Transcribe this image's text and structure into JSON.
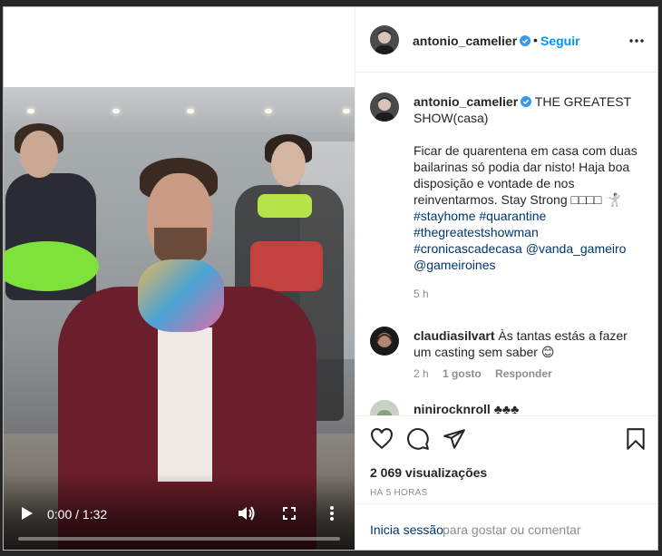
{
  "header": {
    "username": "antonio_camelier",
    "dot": "•",
    "follow": "Seguir"
  },
  "caption": {
    "username": "antonio_camelier",
    "title": "THE GREATEST SHOW(casa)",
    "body": "Ficar de quarentena em casa com duas bailarinas só podia dar nisto! Haja boa disposição e vontade de nos reinventarmos. Stay Strong □□□□ 🤺",
    "tags": [
      "#stayhome",
      "#quarantine",
      "#thegreatestshowman",
      "#cronicascadecasa",
      "@vanda_gameiro",
      "@gameiroines"
    ],
    "time": "5 h"
  },
  "comments": [
    {
      "username": "claudiasilvart",
      "text": "Às tantas estás a fazer um casting sem saber 😊",
      "time": "2 h",
      "likes": "1 gosto",
      "reply": "Responder"
    },
    {
      "username": "ninirocknroll",
      "text": "♣♣♣"
    }
  ],
  "video": {
    "time": "0:00 / 1:32",
    "progress": 0.0
  },
  "stats": {
    "views": "2 069 visualizações",
    "date": "HÁ 5 HORAS"
  },
  "login": {
    "link": "Inicia sessão",
    "rest": "para gostar ou comentar"
  },
  "icons": {
    "verified": "verified-badge-icon",
    "like": "heart-icon",
    "comment": "comment-bubble-icon",
    "share": "paper-plane-icon",
    "save": "bookmark-icon",
    "options": "ellipsis-icon"
  },
  "colors": {
    "accent": "#0095f6",
    "link": "#00376b",
    "muted": "#8e8e8e"
  }
}
